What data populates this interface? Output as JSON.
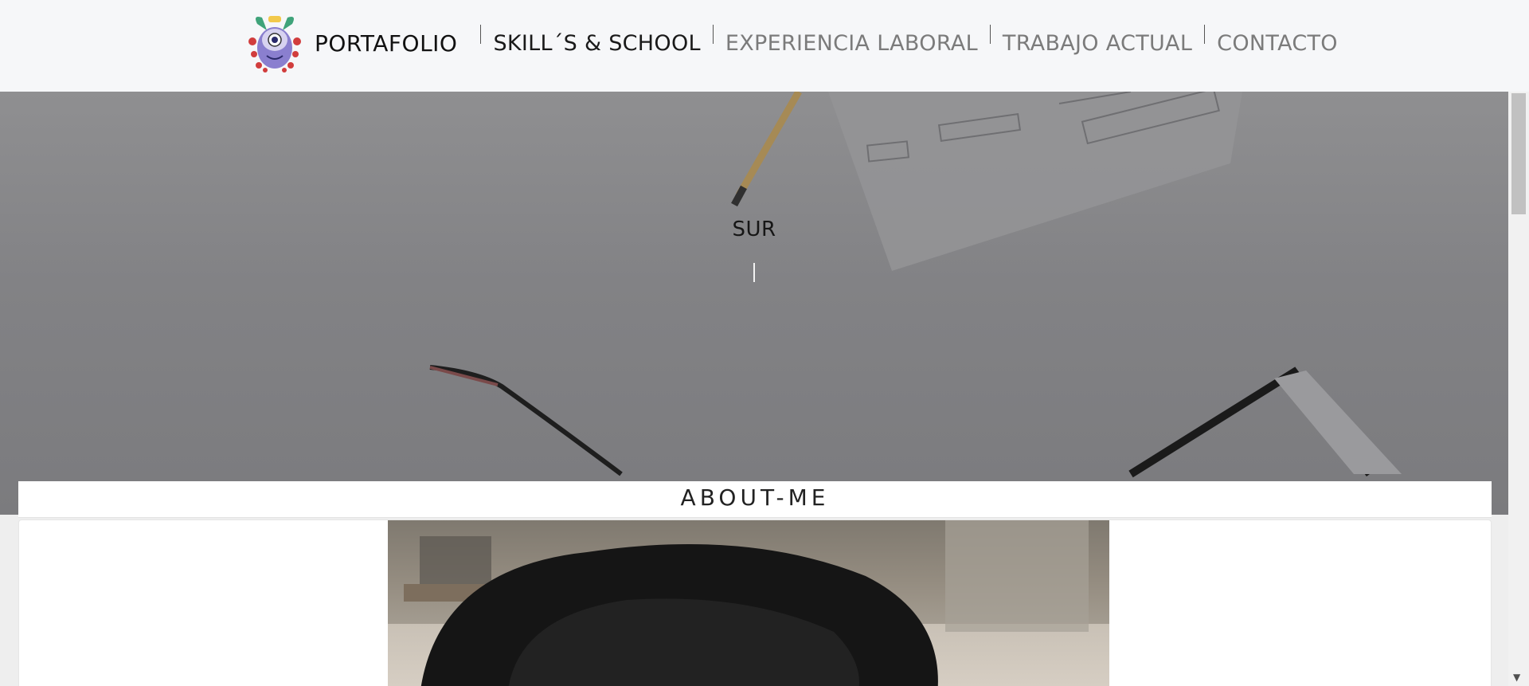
{
  "nav": {
    "brand": "PORTAFOLIO",
    "items": [
      {
        "label": "SKILL´S & SCHOOL",
        "style": "dark"
      },
      {
        "label": "EXPERIENCIA LABORAL",
        "style": "muted"
      },
      {
        "label": "TRABAJO ACTUAL",
        "style": "muted"
      },
      {
        "label": "CONTACTO",
        "style": "muted"
      }
    ]
  },
  "hero": {
    "text": "SUR"
  },
  "about": {
    "title": "ABOUT-ME"
  },
  "icons": {
    "logo": "mascot-logo-icon",
    "scroll_down": "chevron-down-icon"
  },
  "colors": {
    "nav_bg": "#f6f7f9",
    "hero_overlay": "#848487",
    "text_dark": "#1a1a1a",
    "text_muted": "#7b7b7b"
  }
}
